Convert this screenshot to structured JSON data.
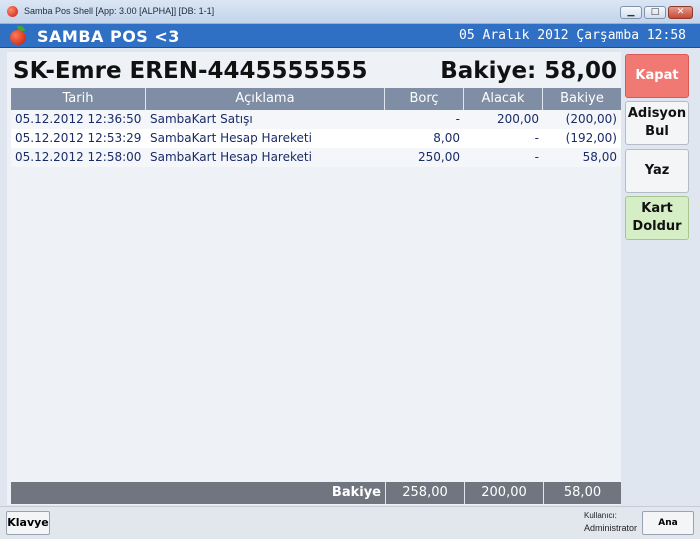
{
  "window": {
    "title": "Samba Pos Shell [App: 3.00 [ALPHA]] [DB: 1-1]",
    "min_symbol": "▁",
    "max_symbol": "□",
    "close_symbol": "✕"
  },
  "header": {
    "app_title": "SAMBA POS <3",
    "datetime": "05 Aralık 2012 Çarşamba 12:58"
  },
  "account": {
    "name": "SK-Emre EREN-4445555555",
    "balance_label": "Bakiye: 58,00"
  },
  "table": {
    "columns": [
      "Tarih",
      "Açıklama",
      "Borç",
      "Alacak",
      "Bakiye"
    ],
    "rows": [
      {
        "date": "05.12.2012 12:36:50",
        "desc": "SambaKart Satışı",
        "borc": "-",
        "alacak": "200,00",
        "bakiye": "(200,00)"
      },
      {
        "date": "05.12.2012 12:53:29",
        "desc": "SambaKart Hesap Hareketi",
        "borc": "8,00",
        "alacak": "-",
        "bakiye": "(192,00)"
      },
      {
        "date": "05.12.2012 12:58:00",
        "desc": "SambaKart Hesap Hareketi",
        "borc": "250,00",
        "alacak": "-",
        "bakiye": "58,00"
      }
    ],
    "footer": {
      "label": "Bakiye",
      "borc": "258,00",
      "alacak": "200,00",
      "bakiye": "58,00"
    }
  },
  "side_buttons": {
    "kapat": "Kapat",
    "adisyon_line1": "Adisyon",
    "adisyon_line2": "Bul",
    "yaz": "Yaz",
    "kart_line1": "Kart",
    "kart_line2": "Doldur"
  },
  "bottom": {
    "klavye": "Klavye",
    "user_label": "Kullanıcı:",
    "user_name": "Administrator",
    "ana_menu": "Ana Menü"
  },
  "colors": {
    "header_bg": "#2f6fc4",
    "kapat_bg": "#f07a73",
    "kart_bg": "#d6eec6",
    "grid_head_bg": "#7f8ea4",
    "row_text": "#1a2c68"
  }
}
